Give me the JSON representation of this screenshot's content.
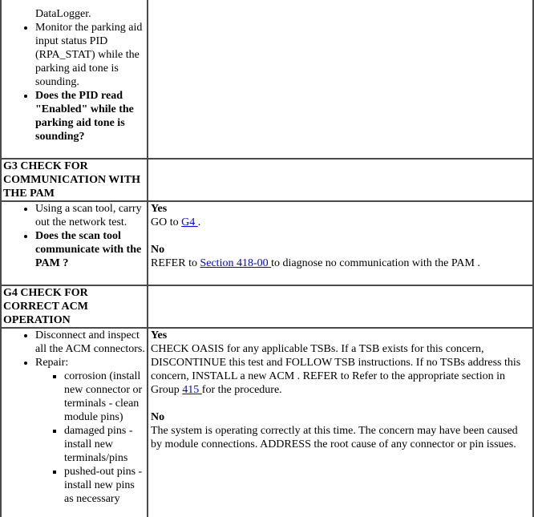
{
  "colors": {
    "border": "#4a4a4a",
    "link": "#0000ee",
    "text": "#000000",
    "background": "#ffffff"
  },
  "g2_continued": {
    "items": [
      {
        "text": "Connect the scan tool and access the DataLogger.",
        "visible_fragment": "DataLogger.",
        "bold": false
      },
      {
        "text": "Monitor the parking aid input status PID (RPA_STAT) while the parking aid tone is sounding.",
        "bold": false
      },
      {
        "text": "Does the PID read \"Enabled\" while the parking aid tone is sounding?",
        "bold": true
      }
    ]
  },
  "steps": [
    {
      "id": "G3",
      "title": "G3 CHECK FOR COMMUNICATION WITH THE PAM",
      "actions": [
        {
          "text": "Using a scan tool, carry out the network test.",
          "bold": false
        },
        {
          "text": "Does the scan tool communicate with the PAM ?",
          "bold": true
        }
      ],
      "results": {
        "yes": {
          "label": "Yes",
          "prefix": "GO to ",
          "link": "G4 ",
          "suffix": "."
        },
        "no": {
          "label": "No",
          "prefix": "REFER to ",
          "link": "Section 418-00 ",
          "suffix": "to diagnose no communication with the PAM ."
        }
      }
    },
    {
      "id": "G4",
      "title": "G4 CHECK FOR CORRECT ACM OPERATION",
      "actions": [
        {
          "text": "Disconnect and inspect all the ACM connectors.",
          "bold": false
        },
        {
          "text": "Repair:",
          "bold": false,
          "subitems": [
            "corrosion (install new connector or terminals - clean module pins)",
            "damaged pins - install new terminals/pins",
            "pushed-out pins - install new pins as necessary"
          ]
        }
      ],
      "results": {
        "yes": {
          "label": "Yes",
          "prefix": "CHECK OASIS for any applicable TSBs. If a TSB exists for this concern, DISCONTINUE this test and FOLLOW TSB instructions. If no TSBs address this concern, INSTALL a new ACM . REFER to Refer to the appropriate section in Group ",
          "link": "415 ",
          "suffix": "for the procedure."
        },
        "no": {
          "label": "No",
          "text": "The system is operating correctly at this time. The concern may have been caused by module connections. ADDRESS the root cause of any connector or pin issues."
        }
      }
    }
  ]
}
